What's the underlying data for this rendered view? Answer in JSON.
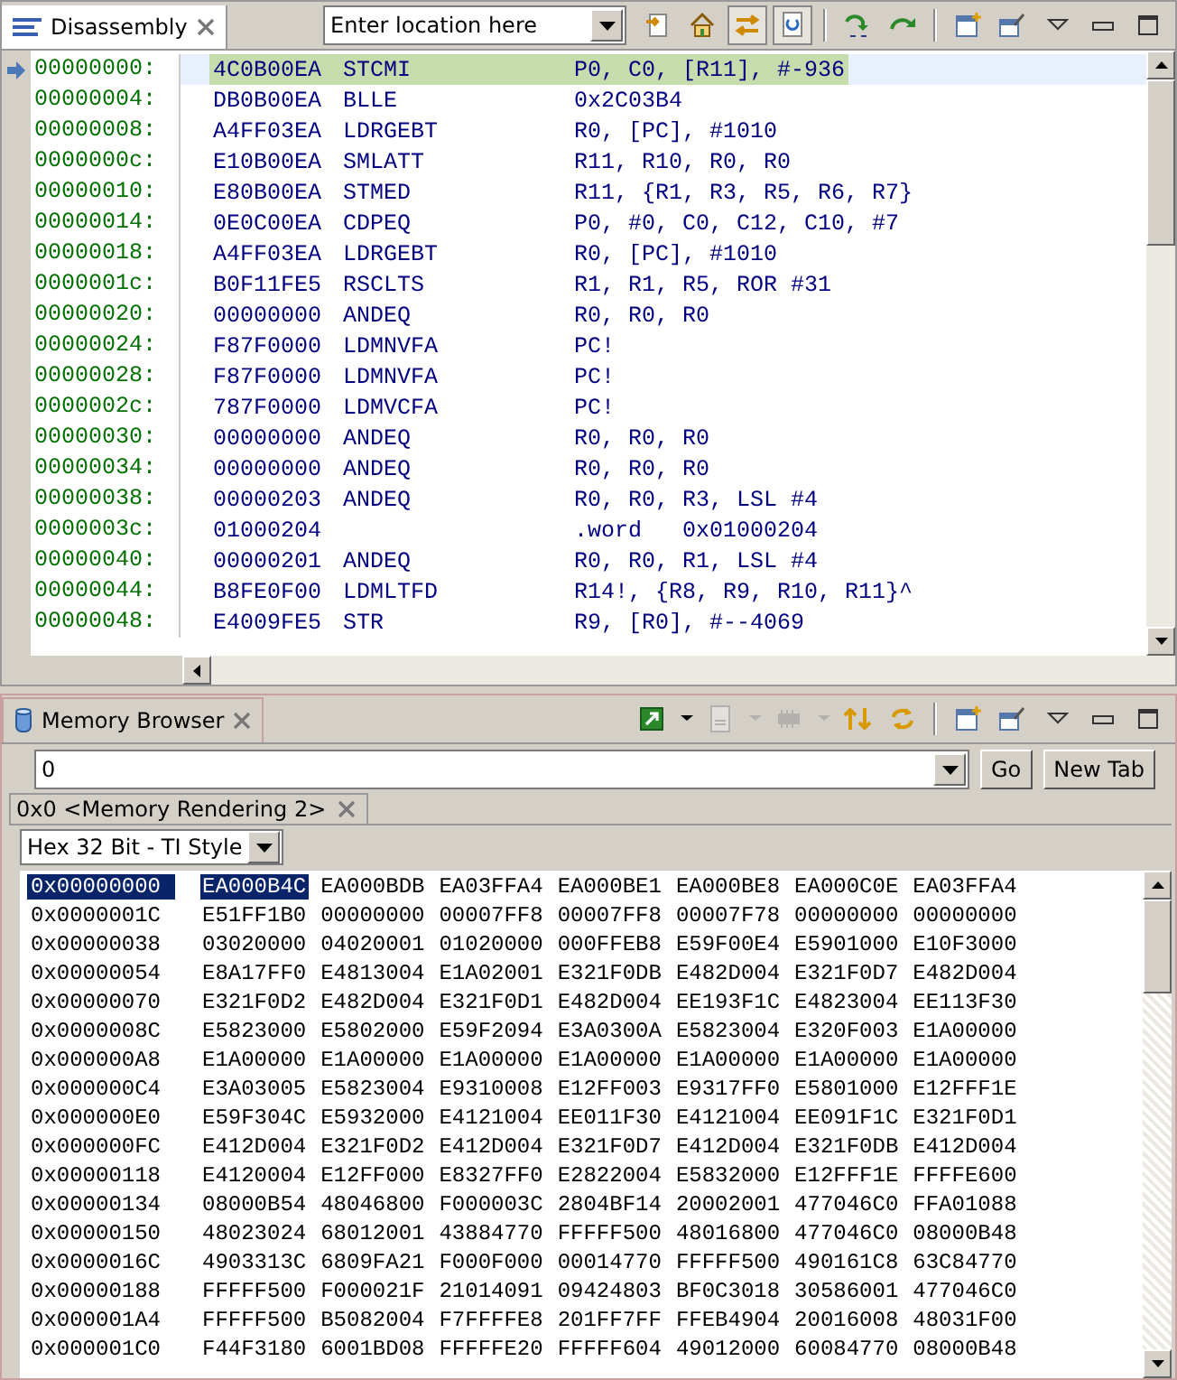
{
  "disassembly_view": {
    "tab": {
      "label": "Disassembly"
    },
    "location_field": {
      "placeholder": "Enter location here"
    },
    "toolbar": [
      {
        "kind": "goto",
        "pressed": false
      },
      {
        "kind": "home",
        "pressed": false
      },
      {
        "kind": "link",
        "pressed": true
      },
      {
        "kind": "sync",
        "pressed": true
      },
      {
        "kind": "sep"
      },
      {
        "kind": "step-into",
        "pressed": false
      },
      {
        "kind": "step-over",
        "pressed": false
      },
      {
        "kind": "sep"
      },
      {
        "kind": "new-view",
        "pressed": false
      },
      {
        "kind": "pin",
        "pressed": false
      },
      {
        "kind": "menu",
        "pressed": false
      },
      {
        "kind": "minimize",
        "pressed": false
      },
      {
        "kind": "maximize",
        "pressed": false
      }
    ],
    "rows": [
      {
        "address": "00000000:",
        "opcode": "4C0B00EA",
        "mnemonic": "STCMI",
        "operands": "P0, C0, [R11], #-936",
        "current": true
      },
      {
        "address": "00000004:",
        "opcode": "DB0B00EA",
        "mnemonic": "BLLE",
        "operands": "0x2C03B4",
        "current": false
      },
      {
        "address": "00000008:",
        "opcode": "A4FF03EA",
        "mnemonic": "LDRGEBT",
        "operands": "R0, [PC], #1010",
        "current": false
      },
      {
        "address": "0000000c:",
        "opcode": "E10B00EA",
        "mnemonic": "SMLATT",
        "operands": "R11, R10, R0, R0",
        "current": false
      },
      {
        "address": "00000010:",
        "opcode": "E80B00EA",
        "mnemonic": "STMED",
        "operands": "R11, {R1, R3, R5, R6, R7}",
        "current": false
      },
      {
        "address": "00000014:",
        "opcode": "0E0C00EA",
        "mnemonic": "CDPEQ",
        "operands": "P0, #0, C0, C12, C10, #7",
        "current": false
      },
      {
        "address": "00000018:",
        "opcode": "A4FF03EA",
        "mnemonic": "LDRGEBT",
        "operands": "R0, [PC], #1010",
        "current": false
      },
      {
        "address": "0000001c:",
        "opcode": "B0F11FE5",
        "mnemonic": "RSCLTS",
        "operands": "R1, R1, R5, ROR #31",
        "current": false
      },
      {
        "address": "00000020:",
        "opcode": "00000000",
        "mnemonic": "ANDEQ",
        "operands": "R0, R0, R0",
        "current": false
      },
      {
        "address": "00000024:",
        "opcode": "F87F0000",
        "mnemonic": "LDMNVFA",
        "operands": "PC!",
        "current": false
      },
      {
        "address": "00000028:",
        "opcode": "F87F0000",
        "mnemonic": "LDMNVFA",
        "operands": "PC!",
        "current": false
      },
      {
        "address": "0000002c:",
        "opcode": "787F0000",
        "mnemonic": "LDMVCFA",
        "operands": "PC!",
        "current": false
      },
      {
        "address": "00000030:",
        "opcode": "00000000",
        "mnemonic": "ANDEQ",
        "operands": "R0, R0, R0",
        "current": false
      },
      {
        "address": "00000034:",
        "opcode": "00000000",
        "mnemonic": "ANDEQ",
        "operands": "R0, R0, R0",
        "current": false
      },
      {
        "address": "00000038:",
        "opcode": "00000203",
        "mnemonic": "ANDEQ",
        "operands": "R0, R0, R3, LSL #4",
        "current": false
      },
      {
        "address": "0000003c:",
        "opcode": "01000204",
        "mnemonic": "",
        "operands": ".word   0x01000204",
        "current": false
      },
      {
        "address": "00000040:",
        "opcode": "00000201",
        "mnemonic": "ANDEQ",
        "operands": "R0, R0, R1, LSL #4",
        "current": false
      },
      {
        "address": "00000044:",
        "opcode": "B8FE0F00",
        "mnemonic": "LDMLTFD",
        "operands": "R14!, {R8, R9, R10, R11}^",
        "current": false
      },
      {
        "address": "00000048:",
        "opcode": "E4009FE5",
        "mnemonic": "STR",
        "operands": "R9, [R0], #--4069",
        "current": false
      }
    ]
  },
  "memory_browser": {
    "tab": {
      "label": "Memory Browser"
    },
    "toolbar": [
      {
        "kind": "connect",
        "disabled": false
      },
      {
        "kind": "dropdown",
        "disabled": false
      },
      {
        "kind": "document",
        "disabled": true
      },
      {
        "kind": "dropdown",
        "disabled": true
      },
      {
        "kind": "chip",
        "disabled": true
      },
      {
        "kind": "dropdown",
        "disabled": true
      },
      {
        "kind": "swap",
        "disabled": false
      },
      {
        "kind": "refresh",
        "disabled": false
      },
      {
        "kind": "sep"
      },
      {
        "kind": "new-view",
        "disabled": false
      },
      {
        "kind": "pin",
        "disabled": false
      },
      {
        "kind": "menu",
        "disabled": false
      },
      {
        "kind": "minimize",
        "disabled": false
      },
      {
        "kind": "maximize",
        "disabled": false
      }
    ],
    "address_field": {
      "value": "0"
    },
    "buttons": [
      "Go",
      "New Tab"
    ],
    "rendering_tab": {
      "label": "0x0 <Memory Rendering 2>"
    },
    "format": {
      "value": "Hex 32 Bit - TI Style"
    },
    "rows": [
      {
        "address": "0x00000000",
        "selected": true,
        "words": [
          {
            "value": "EA000B4C",
            "selected": true
          },
          {
            "value": "EA000BDB",
            "selected": false
          },
          {
            "value": "EA03FFA4",
            "selected": false
          },
          {
            "value": "EA000BE1",
            "selected": false
          },
          {
            "value": "EA000BE8",
            "selected": false
          },
          {
            "value": "EA000C0E",
            "selected": false
          },
          {
            "value": "EA03FFA4",
            "selected": false
          }
        ]
      },
      {
        "address": "0x0000001C",
        "selected": false,
        "words": [
          {
            "value": "E51FF1B0",
            "selected": false
          },
          {
            "value": "00000000",
            "selected": false
          },
          {
            "value": "00007FF8",
            "selected": false
          },
          {
            "value": "00007FF8",
            "selected": false
          },
          {
            "value": "00007F78",
            "selected": false
          },
          {
            "value": "00000000",
            "selected": false
          },
          {
            "value": "00000000",
            "selected": false
          }
        ]
      },
      {
        "address": "0x00000038",
        "selected": false,
        "words": [
          {
            "value": "03020000",
            "selected": false
          },
          {
            "value": "04020001",
            "selected": false
          },
          {
            "value": "01020000",
            "selected": false
          },
          {
            "value": "000FFEB8",
            "selected": false
          },
          {
            "value": "E59F00E4",
            "selected": false
          },
          {
            "value": "E5901000",
            "selected": false
          },
          {
            "value": "E10F3000",
            "selected": false
          }
        ]
      },
      {
        "address": "0x00000054",
        "selected": false,
        "words": [
          {
            "value": "E8A17FF0",
            "selected": false
          },
          {
            "value": "E4813004",
            "selected": false
          },
          {
            "value": "E1A02001",
            "selected": false
          },
          {
            "value": "E321F0DB",
            "selected": false
          },
          {
            "value": "E482D004",
            "selected": false
          },
          {
            "value": "E321F0D7",
            "selected": false
          },
          {
            "value": "E482D004",
            "selected": false
          }
        ]
      },
      {
        "address": "0x00000070",
        "selected": false,
        "words": [
          {
            "value": "E321F0D2",
            "selected": false
          },
          {
            "value": "E482D004",
            "selected": false
          },
          {
            "value": "E321F0D1",
            "selected": false
          },
          {
            "value": "E482D004",
            "selected": false
          },
          {
            "value": "EE193F1C",
            "selected": false
          },
          {
            "value": "E4823004",
            "selected": false
          },
          {
            "value": "EE113F30",
            "selected": false
          }
        ]
      },
      {
        "address": "0x0000008C",
        "selected": false,
        "words": [
          {
            "value": "E5823000",
            "selected": false
          },
          {
            "value": "E5802000",
            "selected": false
          },
          {
            "value": "E59F2094",
            "selected": false
          },
          {
            "value": "E3A0300A",
            "selected": false
          },
          {
            "value": "E5823004",
            "selected": false
          },
          {
            "value": "E320F003",
            "selected": false
          },
          {
            "value": "E1A00000",
            "selected": false
          }
        ]
      },
      {
        "address": "0x000000A8",
        "selected": false,
        "words": [
          {
            "value": "E1A00000",
            "selected": false
          },
          {
            "value": "E1A00000",
            "selected": false
          },
          {
            "value": "E1A00000",
            "selected": false
          },
          {
            "value": "E1A00000",
            "selected": false
          },
          {
            "value": "E1A00000",
            "selected": false
          },
          {
            "value": "E1A00000",
            "selected": false
          },
          {
            "value": "E1A00000",
            "selected": false
          }
        ]
      },
      {
        "address": "0x000000C4",
        "selected": false,
        "words": [
          {
            "value": "E3A03005",
            "selected": false
          },
          {
            "value": "E5823004",
            "selected": false
          },
          {
            "value": "E9310008",
            "selected": false
          },
          {
            "value": "E12FF003",
            "selected": false
          },
          {
            "value": "E9317FF0",
            "selected": false
          },
          {
            "value": "E5801000",
            "selected": false
          },
          {
            "value": "E12FFF1E",
            "selected": false
          }
        ]
      },
      {
        "address": "0x000000E0",
        "selected": false,
        "words": [
          {
            "value": "E59F304C",
            "selected": false
          },
          {
            "value": "E5932000",
            "selected": false
          },
          {
            "value": "E4121004",
            "selected": false
          },
          {
            "value": "EE011F30",
            "selected": false
          },
          {
            "value": "E4121004",
            "selected": false
          },
          {
            "value": "EE091F1C",
            "selected": false
          },
          {
            "value": "E321F0D1",
            "selected": false
          }
        ]
      },
      {
        "address": "0x000000FC",
        "selected": false,
        "words": [
          {
            "value": "E412D004",
            "selected": false
          },
          {
            "value": "E321F0D2",
            "selected": false
          },
          {
            "value": "E412D004",
            "selected": false
          },
          {
            "value": "E321F0D7",
            "selected": false
          },
          {
            "value": "E412D004",
            "selected": false
          },
          {
            "value": "E321F0DB",
            "selected": false
          },
          {
            "value": "E412D004",
            "selected": false
          }
        ]
      },
      {
        "address": "0x00000118",
        "selected": false,
        "words": [
          {
            "value": "E4120004",
            "selected": false
          },
          {
            "value": "E12FF000",
            "selected": false
          },
          {
            "value": "E8327FF0",
            "selected": false
          },
          {
            "value": "E2822004",
            "selected": false
          },
          {
            "value": "E5832000",
            "selected": false
          },
          {
            "value": "E12FFF1E",
            "selected": false
          },
          {
            "value": "FFFFE600",
            "selected": false
          }
        ]
      },
      {
        "address": "0x00000134",
        "selected": false,
        "words": [
          {
            "value": "08000B54",
            "selected": false
          },
          {
            "value": "48046800",
            "selected": false
          },
          {
            "value": "F000003C",
            "selected": false
          },
          {
            "value": "2804BF14",
            "selected": false
          },
          {
            "value": "20002001",
            "selected": false
          },
          {
            "value": "477046C0",
            "selected": false
          },
          {
            "value": "FFA01088",
            "selected": false
          }
        ]
      },
      {
        "address": "0x00000150",
        "selected": false,
        "words": [
          {
            "value": "48023024",
            "selected": false
          },
          {
            "value": "68012001",
            "selected": false
          },
          {
            "value": "43884770",
            "selected": false
          },
          {
            "value": "FFFFF500",
            "selected": false
          },
          {
            "value": "48016800",
            "selected": false
          },
          {
            "value": "477046C0",
            "selected": false
          },
          {
            "value": "08000B48",
            "selected": false
          }
        ]
      },
      {
        "address": "0x0000016C",
        "selected": false,
        "words": [
          {
            "value": "4903313C",
            "selected": false
          },
          {
            "value": "6809FA21",
            "selected": false
          },
          {
            "value": "F000F000",
            "selected": false
          },
          {
            "value": "00014770",
            "selected": false
          },
          {
            "value": "FFFFF500",
            "selected": false
          },
          {
            "value": "490161C8",
            "selected": false
          },
          {
            "value": "63C84770",
            "selected": false
          }
        ]
      },
      {
        "address": "0x00000188",
        "selected": false,
        "words": [
          {
            "value": "FFFFF500",
            "selected": false
          },
          {
            "value": "F000021F",
            "selected": false
          },
          {
            "value": "21014091",
            "selected": false
          },
          {
            "value": "09424803",
            "selected": false
          },
          {
            "value": "BF0C3018",
            "selected": false
          },
          {
            "value": "30586001",
            "selected": false
          },
          {
            "value": "477046C0",
            "selected": false
          }
        ]
      },
      {
        "address": "0x000001A4",
        "selected": false,
        "words": [
          {
            "value": "FFFFF500",
            "selected": false
          },
          {
            "value": "B5082004",
            "selected": false
          },
          {
            "value": "F7FFFFE8",
            "selected": false
          },
          {
            "value": "201FF7FF",
            "selected": false
          },
          {
            "value": "FFEB4904",
            "selected": false
          },
          {
            "value": "20016008",
            "selected": false
          },
          {
            "value": "48031F00",
            "selected": false
          }
        ]
      },
      {
        "address": "0x000001C0",
        "selected": false,
        "words": [
          {
            "value": "F44F3180",
            "selected": false
          },
          {
            "value": "6001BD08",
            "selected": false
          },
          {
            "value": "FFFFFE20",
            "selected": false
          },
          {
            "value": "FFFFF604",
            "selected": false
          },
          {
            "value": "49012000",
            "selected": false
          },
          {
            "value": "60084770",
            "selected": false
          },
          {
            "value": "08000B48",
            "selected": false
          }
        ]
      }
    ]
  }
}
